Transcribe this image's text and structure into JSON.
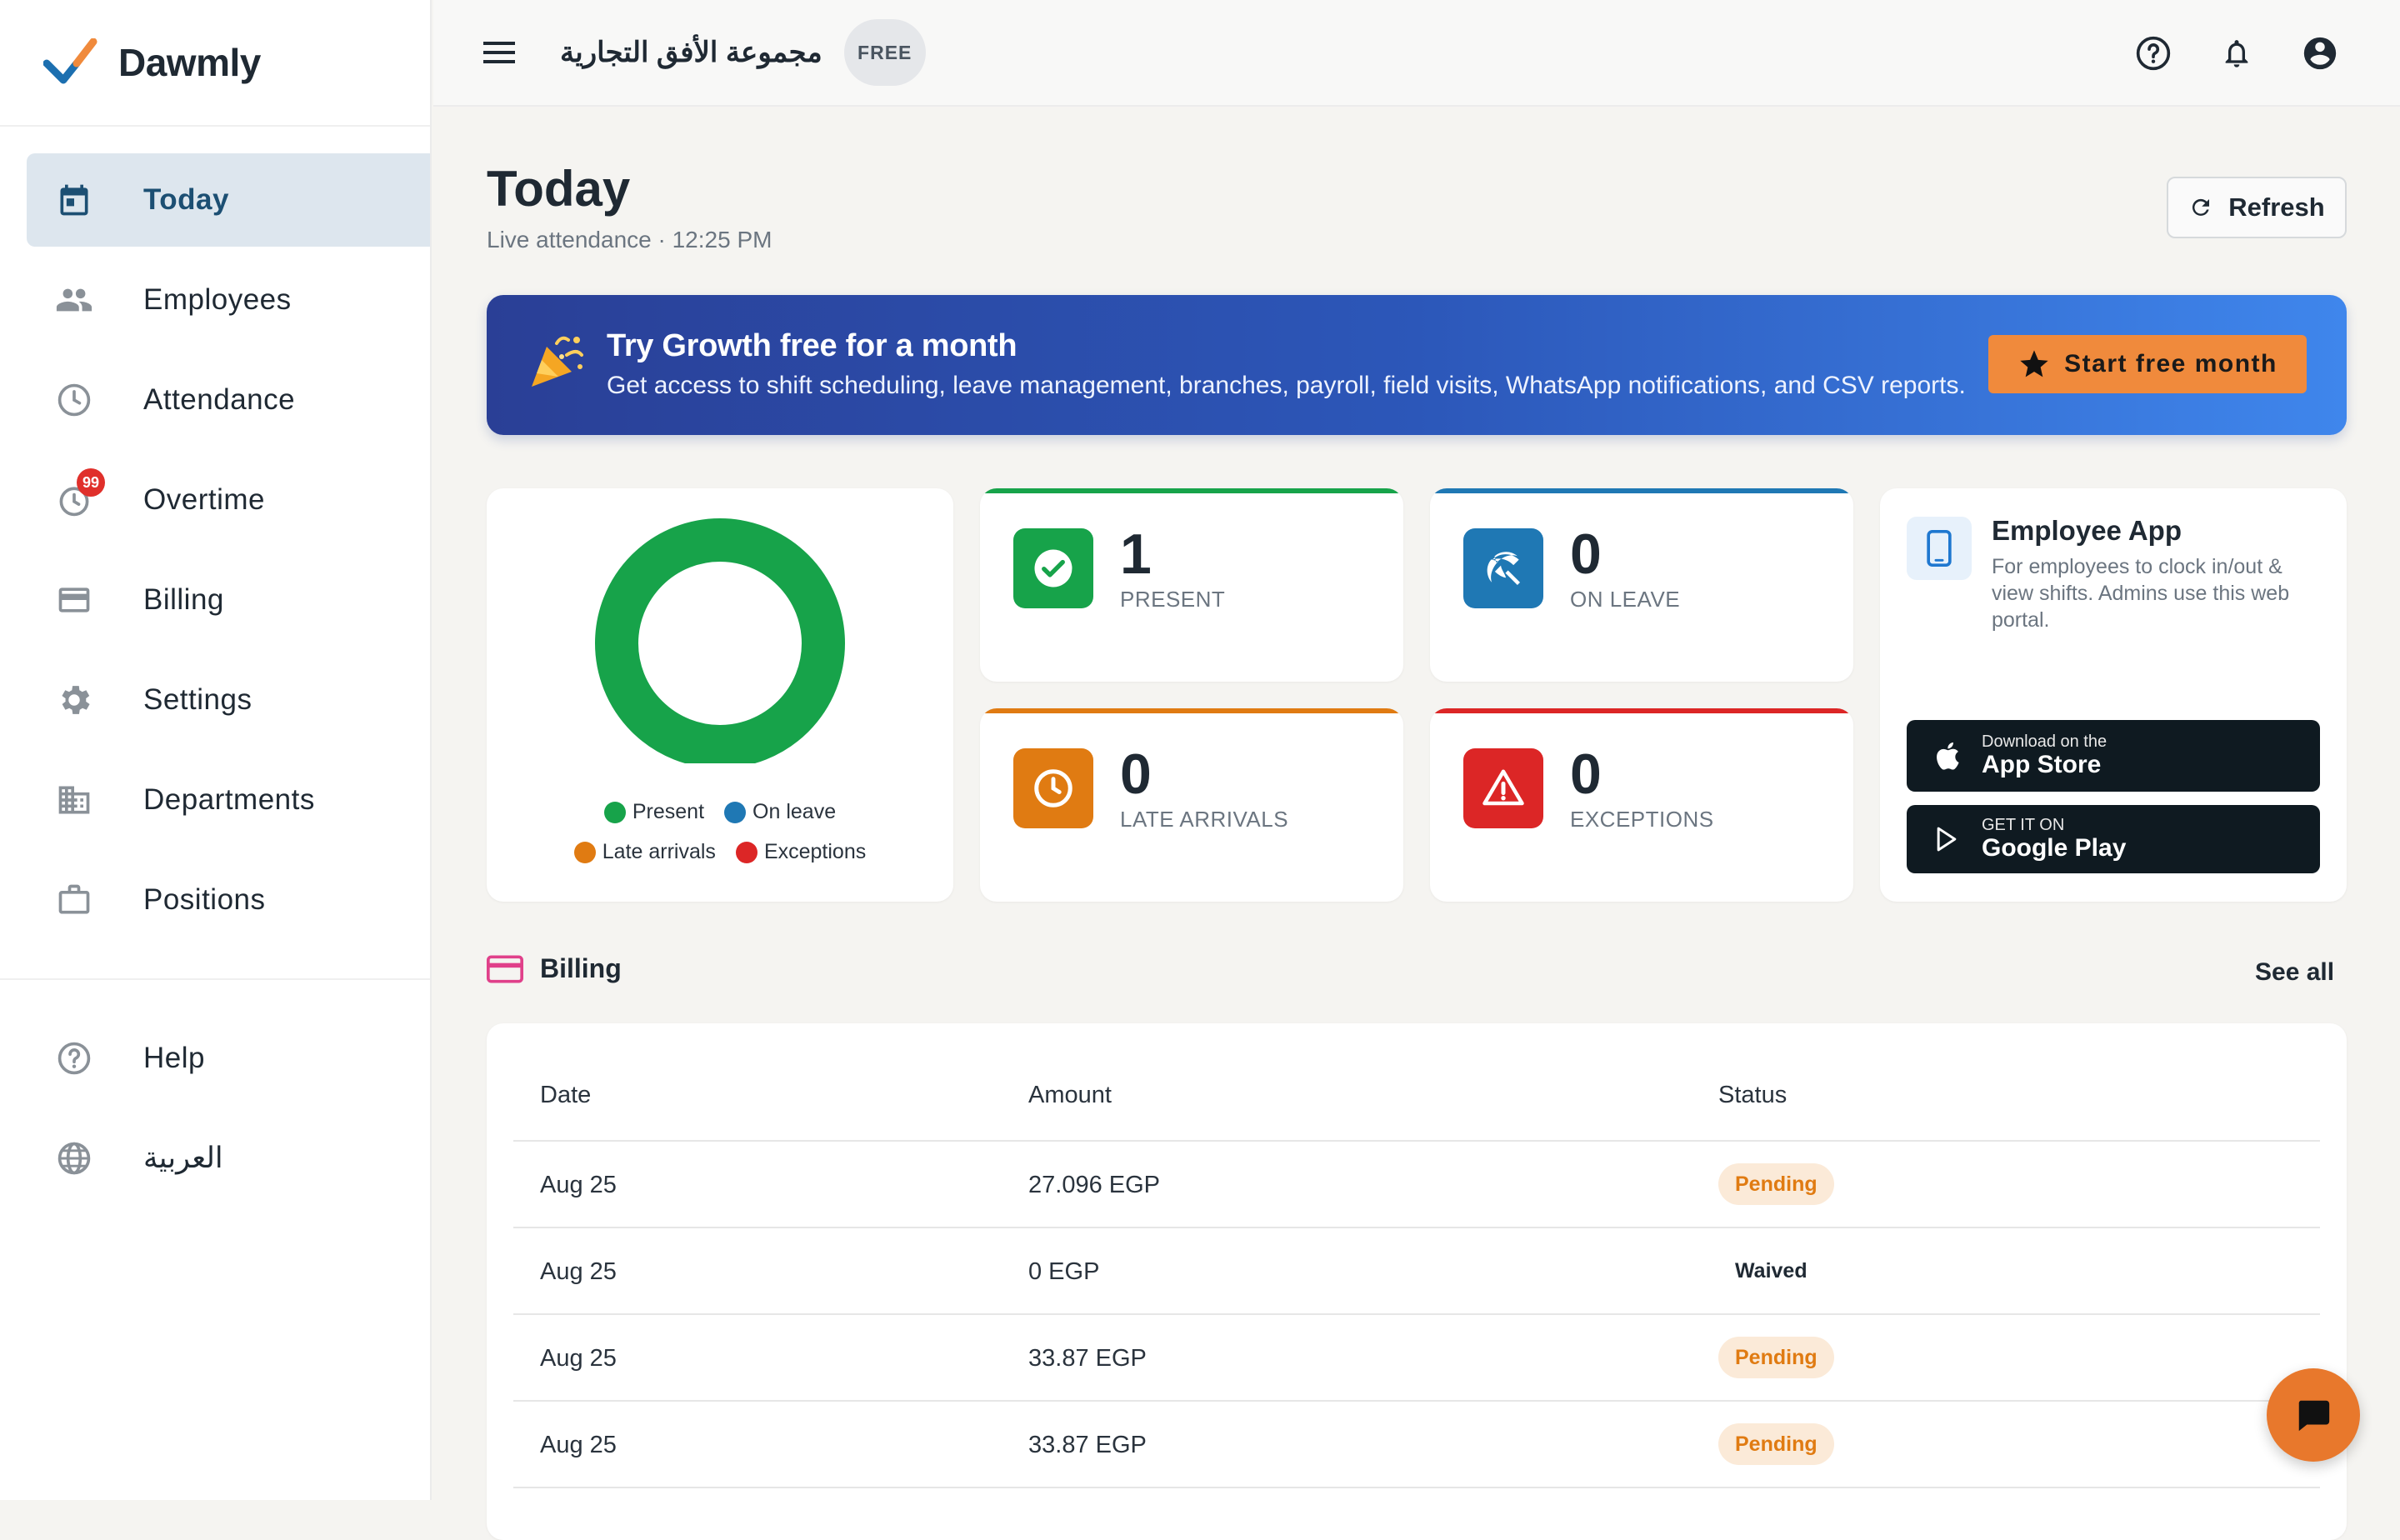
{
  "brand": {
    "name": "Dawmly",
    "accent": "#1c6fb0"
  },
  "sidebar": {
    "items": [
      {
        "label": "Today",
        "icon": "calendar-icon",
        "active": true
      },
      {
        "label": "Employees",
        "icon": "people-icon"
      },
      {
        "label": "Attendance",
        "icon": "clock-icon"
      },
      {
        "label": "Overtime",
        "icon": "overtime-clock-icon",
        "badge": "99"
      },
      {
        "label": "Billing",
        "icon": "credit-card-icon"
      },
      {
        "label": "Settings",
        "icon": "gear-icon"
      },
      {
        "label": "Departments",
        "icon": "building-icon"
      },
      {
        "label": "Positions",
        "icon": "briefcase-icon"
      }
    ],
    "bottom": [
      {
        "label": "Help",
        "icon": "help-circle-icon"
      },
      {
        "label": "العربية",
        "icon": "globe-icon"
      }
    ]
  },
  "topbar": {
    "company": "مجموعة الأفق التجارية",
    "plan": "FREE"
  },
  "page": {
    "title": "Today",
    "subtitle": "Live attendance · 12:25 PM",
    "refresh_label": "Refresh"
  },
  "promo": {
    "title": "Try Growth free for a month",
    "text": "Get access to shift scheduling, leave management, branches, payroll, field visits, WhatsApp notifications, and CSV reports.",
    "button_label": "Start free month"
  },
  "donut": {
    "legend": [
      {
        "label": "Present",
        "color": "#17a34a"
      },
      {
        "label": "On leave",
        "color": "#1f78b4"
      },
      {
        "label": "Late arrivals",
        "color": "#e07b12"
      },
      {
        "label": "Exceptions",
        "color": "#dc2626"
      }
    ]
  },
  "stats": [
    {
      "value": "1",
      "label": "PRESENT",
      "color": "#17a34a",
      "icon": "check-circle-icon"
    },
    {
      "value": "0",
      "label": "ON LEAVE",
      "color": "#1f78b4",
      "icon": "beach-umbrella-icon"
    },
    {
      "value": "0",
      "label": "LATE ARRIVALS",
      "color": "#e07b12",
      "icon": "clock-icon"
    },
    {
      "value": "0",
      "label": "EXCEPTIONS",
      "color": "#dc2626",
      "icon": "warning-icon"
    }
  ],
  "app": {
    "title": "Employee App",
    "description": "For employees to clock in/out & view shifts. Admins use this web portal.",
    "appstore_small": "Download on the",
    "appstore_big": "App Store",
    "play_small": "GET IT ON",
    "play_big": "Google Play"
  },
  "billing": {
    "title": "Billing",
    "see_all": "See all",
    "columns": [
      "Date",
      "Amount",
      "Status"
    ],
    "rows": [
      {
        "date": "Aug 25",
        "amount": "27.096 EGP",
        "status": "Pending"
      },
      {
        "date": "Aug 25",
        "amount": "0 EGP",
        "status": "Waived"
      },
      {
        "date": "Aug 25",
        "amount": "33.87 EGP",
        "status": "Pending"
      },
      {
        "date": "Aug 25",
        "amount": "33.87 EGP",
        "status": "Pending"
      }
    ]
  }
}
